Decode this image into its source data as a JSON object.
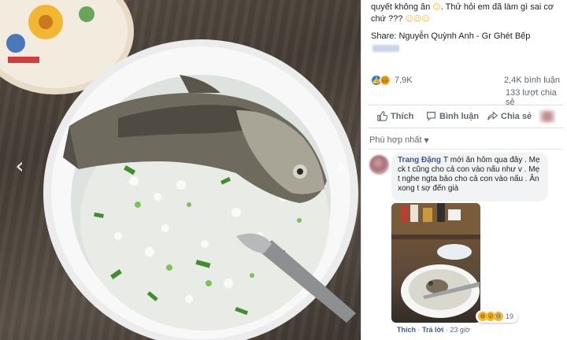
{
  "post": {
    "caption_line": "quyết không ăn",
    "caption_rest": ". Thử hỏi em đã làm gì sai cơ",
    "caption_line2": "chứ ???",
    "caption_emoji": "☺",
    "caption_emojis2": "☺☺☺",
    "share_line": "Share: Nguyễn Quỳnh Anh - Gr Ghét Bếp"
  },
  "stats": {
    "reaction_count": "7,9K",
    "comments": "2,4K bình luận",
    "shares": "133 lượt chia sẻ"
  },
  "actions": {
    "like": "Thích",
    "comment": "Bình luận",
    "share": "Chia sẻ"
  },
  "comments_filter": {
    "label": "Phù hợp nhất"
  },
  "comment": {
    "author": "Trang Đặng",
    "text": "T mới ăn hôm qua đây . Mẹ ck t cũng cho cả con vào nấu như v . Mẹ t nghe ngta bảo cho cả con vào nấu . Ăn xong t sợ đến già",
    "like_label": "Thích",
    "reply_label": "Trả lời",
    "time": "23 giờ",
    "reaction_count": "19"
  },
  "viewer": {
    "prev_arrow": "‹",
    "next_arrow": "›"
  },
  "colors": {
    "accent_blue": "#385898",
    "like_blue": "#2078f4",
    "reaction_yellow": "#f7b928"
  }
}
